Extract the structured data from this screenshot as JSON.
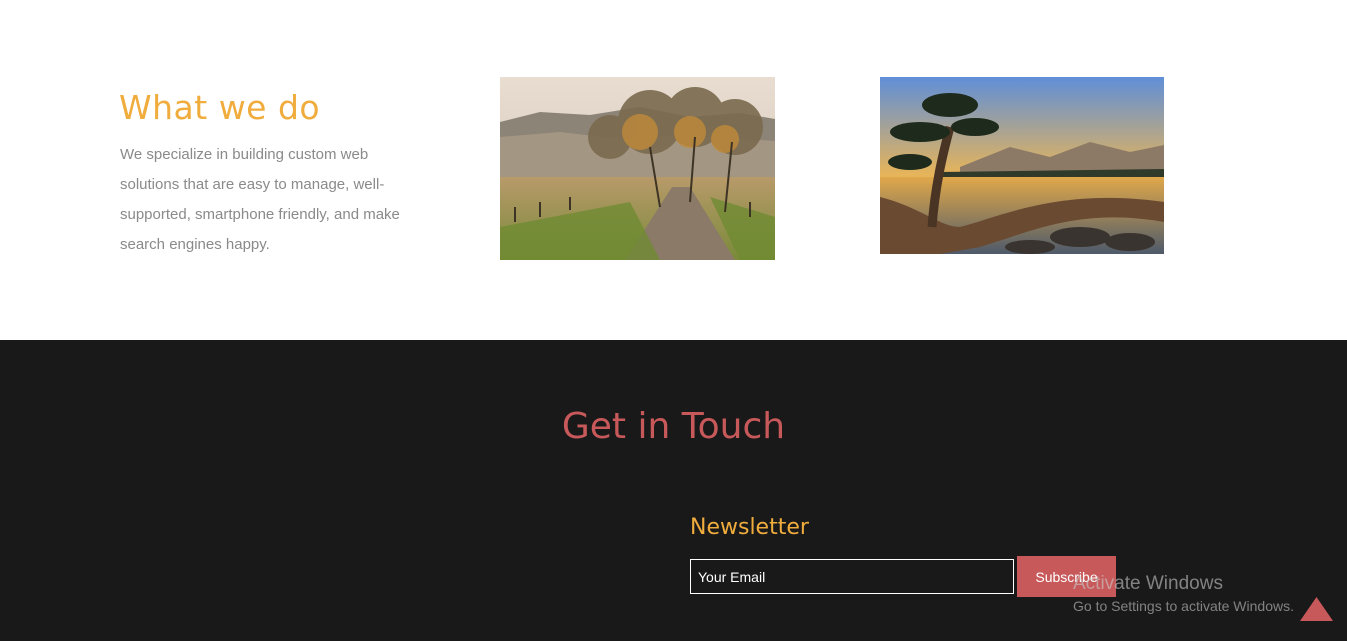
{
  "what_we_do": {
    "title": "What we do",
    "description": "We specialize in building custom web solutions that are easy to manage, well-supported, smartphone friendly, and make search engines happy.",
    "images": [
      "autumn-road-photo",
      "lake-tree-photo"
    ]
  },
  "contact": {
    "title": "Get in Touch",
    "newsletter": {
      "title": "Newsletter",
      "email_placeholder": "Your Email",
      "subscribe_label": "Subscribe"
    }
  },
  "watermark": {
    "title": "Activate Windows",
    "subtitle": "Go to Settings to activate Windows."
  },
  "icons": {
    "scroll_top": "triangle-up-icon"
  },
  "colors": {
    "accent_orange": "#f0ac3c",
    "accent_red": "#c8595a",
    "dark_background": "#1a191a",
    "body_text": "#8a8a8a"
  }
}
